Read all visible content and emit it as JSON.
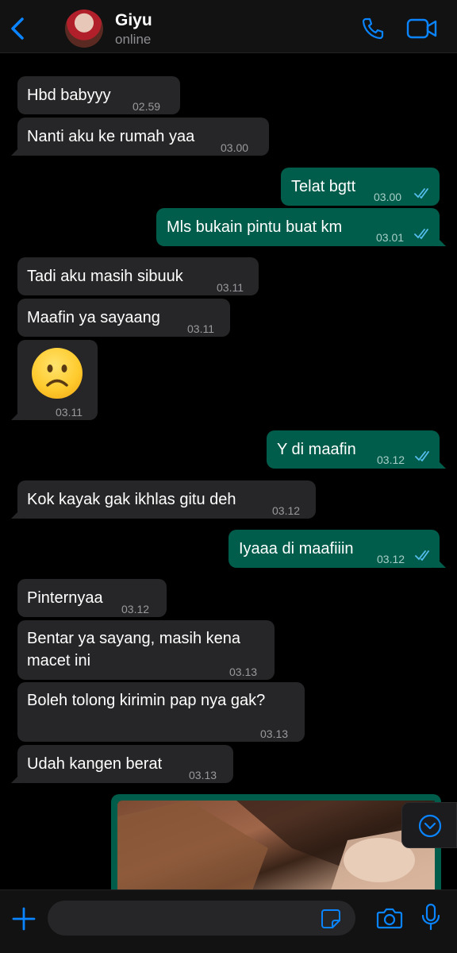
{
  "header": {
    "contact_name": "Giyu",
    "contact_status": "online"
  },
  "colors": {
    "accent": "#0a84ff",
    "incoming_bubble": "#262628",
    "outgoing_bubble": "#005c4b",
    "read_ticks": "#53bdeb"
  },
  "messages": [
    {
      "direction": "in",
      "text": "Hbd babyyy",
      "time": "02.59"
    },
    {
      "direction": "in",
      "text": "Nanti aku ke rumah yaa",
      "time": "03.00"
    },
    {
      "direction": "out",
      "text": "Telat bgtt",
      "time": "03.00",
      "status": "read"
    },
    {
      "direction": "out",
      "text": "Mls bukain pintu buat km",
      "time": "03.01",
      "status": "read"
    },
    {
      "direction": "in",
      "text": "Tadi aku masih sibuuk",
      "time": "03.11"
    },
    {
      "direction": "in",
      "text": "Maafin ya sayaang",
      "time": "03.11"
    },
    {
      "direction": "in",
      "emoji": "slightly-frowning-face",
      "time": "03.11"
    },
    {
      "direction": "out",
      "text": "Y di maafin",
      "time": "03.12",
      "status": "read"
    },
    {
      "direction": "in",
      "text": "Kok kayak gak ikhlas gitu deh",
      "time": "03.12"
    },
    {
      "direction": "out",
      "text": "Iyaaa di maafiiin",
      "time": "03.12",
      "status": "read"
    },
    {
      "direction": "in",
      "text": "Pinternyaa",
      "time": "03.12"
    },
    {
      "direction": "in",
      "lines": [
        "Bentar ya sayang, masih kena",
        "macet ini"
      ],
      "time": "03.13"
    },
    {
      "direction": "in",
      "text": "Boleh tolong kirimin pap nya gak?",
      "time": "03.13"
    },
    {
      "direction": "in",
      "text": "Udah kangen berat",
      "time": "03.13"
    },
    {
      "direction": "out",
      "type": "photo"
    }
  ],
  "composer": {
    "placeholder": ""
  },
  "icons": {
    "back": "chevron-left-icon",
    "call": "phone-icon",
    "video": "video-camera-icon",
    "scroll_down": "chevron-down-circle-icon",
    "plus": "plus-icon",
    "sticker": "sticker-icon",
    "camera": "camera-icon",
    "mic": "microphone-icon"
  }
}
